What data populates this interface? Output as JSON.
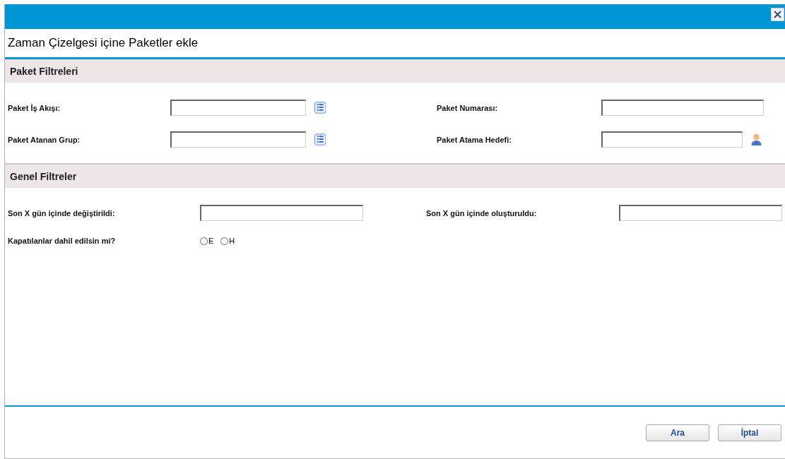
{
  "dialog": {
    "title": "Zaman Çizelgesi içine Paketler ekle"
  },
  "sections": [
    {
      "title": "Paket Filtreleri",
      "rows": [
        [
          {
            "label": "Paket İş Akışı:",
            "kind": "list"
          },
          {
            "label": "Paket Numarası:",
            "kind": "text"
          }
        ],
        [
          {
            "label": "Paket Atanan Grup:",
            "kind": "list"
          },
          {
            "label": "Paket Atama Hedefi:",
            "kind": "person"
          }
        ]
      ]
    },
    {
      "title": "Genel Filtreler",
      "rows": [
        [
          {
            "label": "Son X gün içinde değiştirildi:",
            "kind": "text"
          },
          {
            "label": "Son X gün içinde oluşturuldu:",
            "kind": "text"
          }
        ],
        [
          {
            "label": "Kapatılanlar dahil edilsin mi?",
            "kind": "radio",
            "options": [
              {
                "label": "E",
                "selected": false
              },
              {
                "label": "H",
                "selected": false
              }
            ]
          }
        ]
      ]
    }
  ],
  "buttons": [
    "Ara",
    "İptal"
  ]
}
